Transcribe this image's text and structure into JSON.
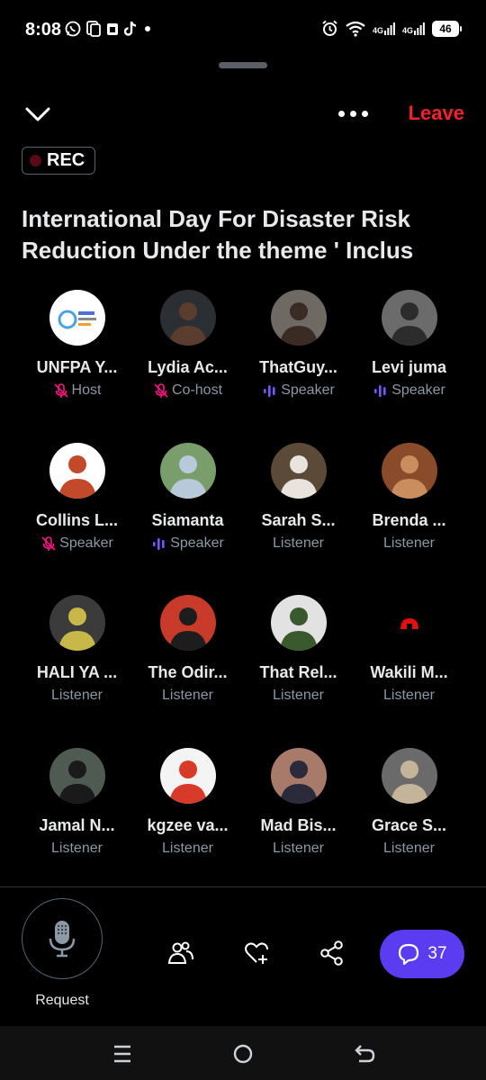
{
  "status_bar": {
    "time": "8:08",
    "left_icons": [
      "whatsapp-icon",
      "screenshot-icon",
      "sim-icon",
      "tiktok-icon",
      "dot-icon"
    ],
    "network_1": "4G",
    "network_2": "4G",
    "battery": "46"
  },
  "header": {
    "leave_label": "Leave",
    "rec_label": "REC"
  },
  "space": {
    "title_line1": "International Day For Disaster Risk",
    "title_line2": "Reduction Under the theme ' Inclus"
  },
  "colors": {
    "accent_leave": "#f4212e",
    "speaking_purple": "#7856ff",
    "muted_pink": "#f91880",
    "chat_button": "#5b3cf0"
  },
  "participants": [
    {
      "name": "UNFPA Y...",
      "role": "Host",
      "role_icon": "mic-muted-icon",
      "avatar": "unfpa-logo"
    },
    {
      "name": "Lydia Ac...",
      "role": "Co-host",
      "role_icon": "mic-muted-icon",
      "avatar": "photo"
    },
    {
      "name": "ThatGuy...",
      "role": "Speaker",
      "role_icon": "speaking-bars-icon",
      "avatar": "photo"
    },
    {
      "name": "Levi juma",
      "role": "Speaker",
      "role_icon": "speaking-bars-icon",
      "avatar": "photo"
    },
    {
      "name": "Collins L...",
      "role": "Speaker",
      "role_icon": "mic-muted-icon",
      "avatar": "photo"
    },
    {
      "name": "Siamanta",
      "role": "Speaker",
      "role_icon": "speaking-bars-icon",
      "avatar": "photo"
    },
    {
      "name": "Sarah S...",
      "role": "Listener",
      "role_icon": "",
      "avatar": "photo"
    },
    {
      "name": "Brenda ...",
      "role": "Listener",
      "role_icon": "",
      "avatar": "photo"
    },
    {
      "name": "HALI YA ...",
      "role": "Listener",
      "role_icon": "",
      "avatar": "photo"
    },
    {
      "name": "The Odir...",
      "role": "Listener",
      "role_icon": "",
      "avatar": "photo"
    },
    {
      "name": "That Rel...",
      "role": "Listener",
      "role_icon": "",
      "avatar": "photo"
    },
    {
      "name": "Wakili M...",
      "role": "Listener",
      "role_icon": "",
      "avatar": "red-emblem"
    },
    {
      "name": "Jamal N...",
      "role": "Listener",
      "role_icon": "",
      "avatar": "photo"
    },
    {
      "name": "kgzee va...",
      "role": "Listener",
      "role_icon": "",
      "avatar": "photo"
    },
    {
      "name": "Mad Bis...",
      "role": "Listener",
      "role_icon": "",
      "avatar": "photo"
    },
    {
      "name": "Grace S...",
      "role": "Listener",
      "role_icon": "",
      "avatar": "photo"
    }
  ],
  "bottom_bar": {
    "request_label": "Request",
    "chat_count": "37",
    "actions": [
      "people-icon",
      "heart-plus-icon",
      "share-icon"
    ]
  },
  "nav_bar": {
    "buttons": [
      "recents-icon",
      "home-icon",
      "back-icon"
    ]
  }
}
